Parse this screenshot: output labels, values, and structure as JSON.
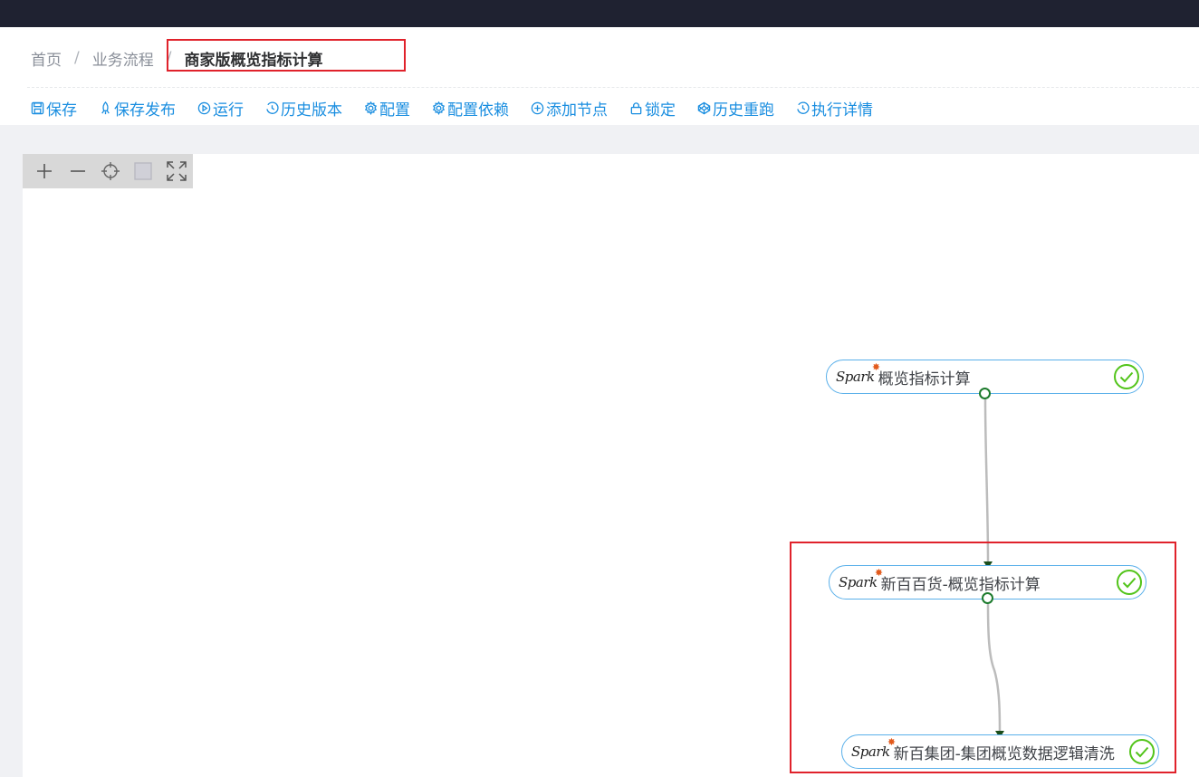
{
  "breadcrumb": {
    "home": "首页",
    "sep": "/",
    "flow": "业务流程",
    "current": "商家版概览指标计算"
  },
  "toolbar": [
    {
      "label": "保存",
      "icon": "save-icon"
    },
    {
      "label": "保存发布",
      "icon": "rocket-icon"
    },
    {
      "label": "运行",
      "icon": "play-icon"
    },
    {
      "label": "历史版本",
      "icon": "history-icon"
    },
    {
      "label": "配置",
      "icon": "gear-icon"
    },
    {
      "label": "配置依赖",
      "icon": "gear-icon"
    },
    {
      "label": "添加节点",
      "icon": "plus-circle-icon"
    },
    {
      "label": "锁定",
      "icon": "lock-icon"
    },
    {
      "label": "历史重跑",
      "icon": "codepen-icon"
    },
    {
      "label": "执行详情",
      "icon": "history-icon"
    }
  ],
  "zoom_controls": [
    "zoom-in-icon",
    "zoom-out-icon",
    "locate-icon",
    "fit-square-icon",
    "fullscreen-icon"
  ],
  "nodes": [
    {
      "type_logo": "Spark",
      "label": "概览指标计算",
      "status": "success"
    },
    {
      "type_logo": "Spark",
      "label": "新百百货-概览指标计算",
      "status": "success"
    },
    {
      "type_logo": "Spark",
      "label": "新百集团-集团概览数据逻辑清洗",
      "status": "success"
    }
  ],
  "colors": {
    "accent": "#1a8ee0",
    "highlight": "#e0222b",
    "success": "#52c41a",
    "topbar": "#1f2231"
  }
}
